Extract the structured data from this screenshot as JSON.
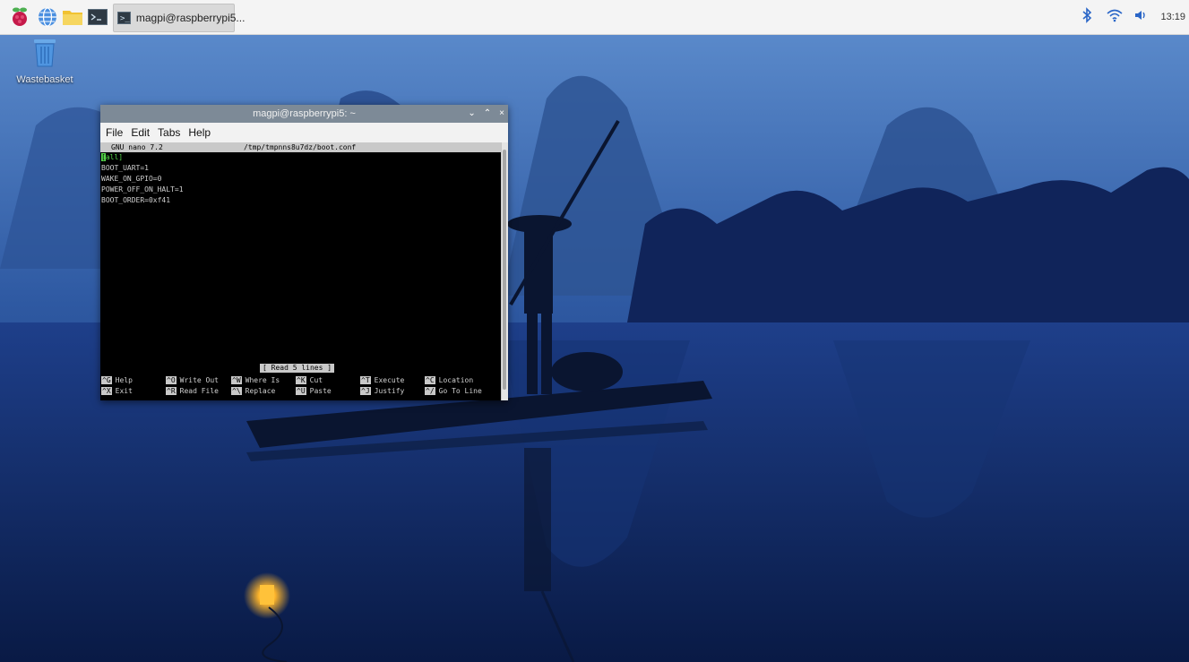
{
  "taskbar": {
    "launchers": [
      {
        "name": "raspberry-menu-icon"
      },
      {
        "name": "browser-globe-icon"
      },
      {
        "name": "file-manager-folder-icon"
      },
      {
        "name": "terminal-icon"
      }
    ],
    "task_button_label": "magpi@raspberrypi5...",
    "task_button_icon_text": ">_",
    "tray": {
      "bluetooth_icon": "bluetooth-icon",
      "wifi_icon": "wifi-icon",
      "volume_icon": "volume-icon",
      "clock": "13:19"
    },
    "colors": {
      "bar": "#f4f4f4",
      "tray_icon": "#2a66c7"
    }
  },
  "desktop": {
    "wastebasket_label": "Wastebasket",
    "wallpaper": "night river scene with cormorant fisherman on bamboo raft and lantern"
  },
  "terminal": {
    "title": "magpi@raspberrypi5: ~",
    "controls": [
      "⌄",
      "⌃",
      "×"
    ],
    "menu": [
      "File",
      "Edit",
      "Tabs",
      "Help"
    ],
    "nano": {
      "version": "GNU nano 7.2",
      "path": "/tmp/tmpnns8u7dz/boot.conf",
      "lines": [
        {
          "cursor": "[",
          "text": "all]"
        },
        {
          "text": "BOOT_UART=1"
        },
        {
          "text": "WAKE_ON_GPIO=0"
        },
        {
          "text": "POWER_OFF_ON_HALT=1"
        },
        {
          "text": "BOOT_ORDER=0xf41"
        }
      ],
      "status": "[ Read 5 lines ]",
      "shortcuts_row1": [
        {
          "key": "^G",
          "label": "Help"
        },
        {
          "key": "^O",
          "label": "Write Out"
        },
        {
          "key": "^W",
          "label": "Where Is"
        },
        {
          "key": "^K",
          "label": "Cut"
        },
        {
          "key": "^T",
          "label": "Execute"
        },
        {
          "key": "^C",
          "label": "Location"
        }
      ],
      "shortcuts_row2": [
        {
          "key": "^X",
          "label": "Exit"
        },
        {
          "key": "^R",
          "label": "Read File"
        },
        {
          "key": "^\\",
          "label": "Replace"
        },
        {
          "key": "^U",
          "label": "Paste"
        },
        {
          "key": "^J",
          "label": "Justify"
        },
        {
          "key": "^/",
          "label": "Go To Line"
        }
      ]
    }
  }
}
